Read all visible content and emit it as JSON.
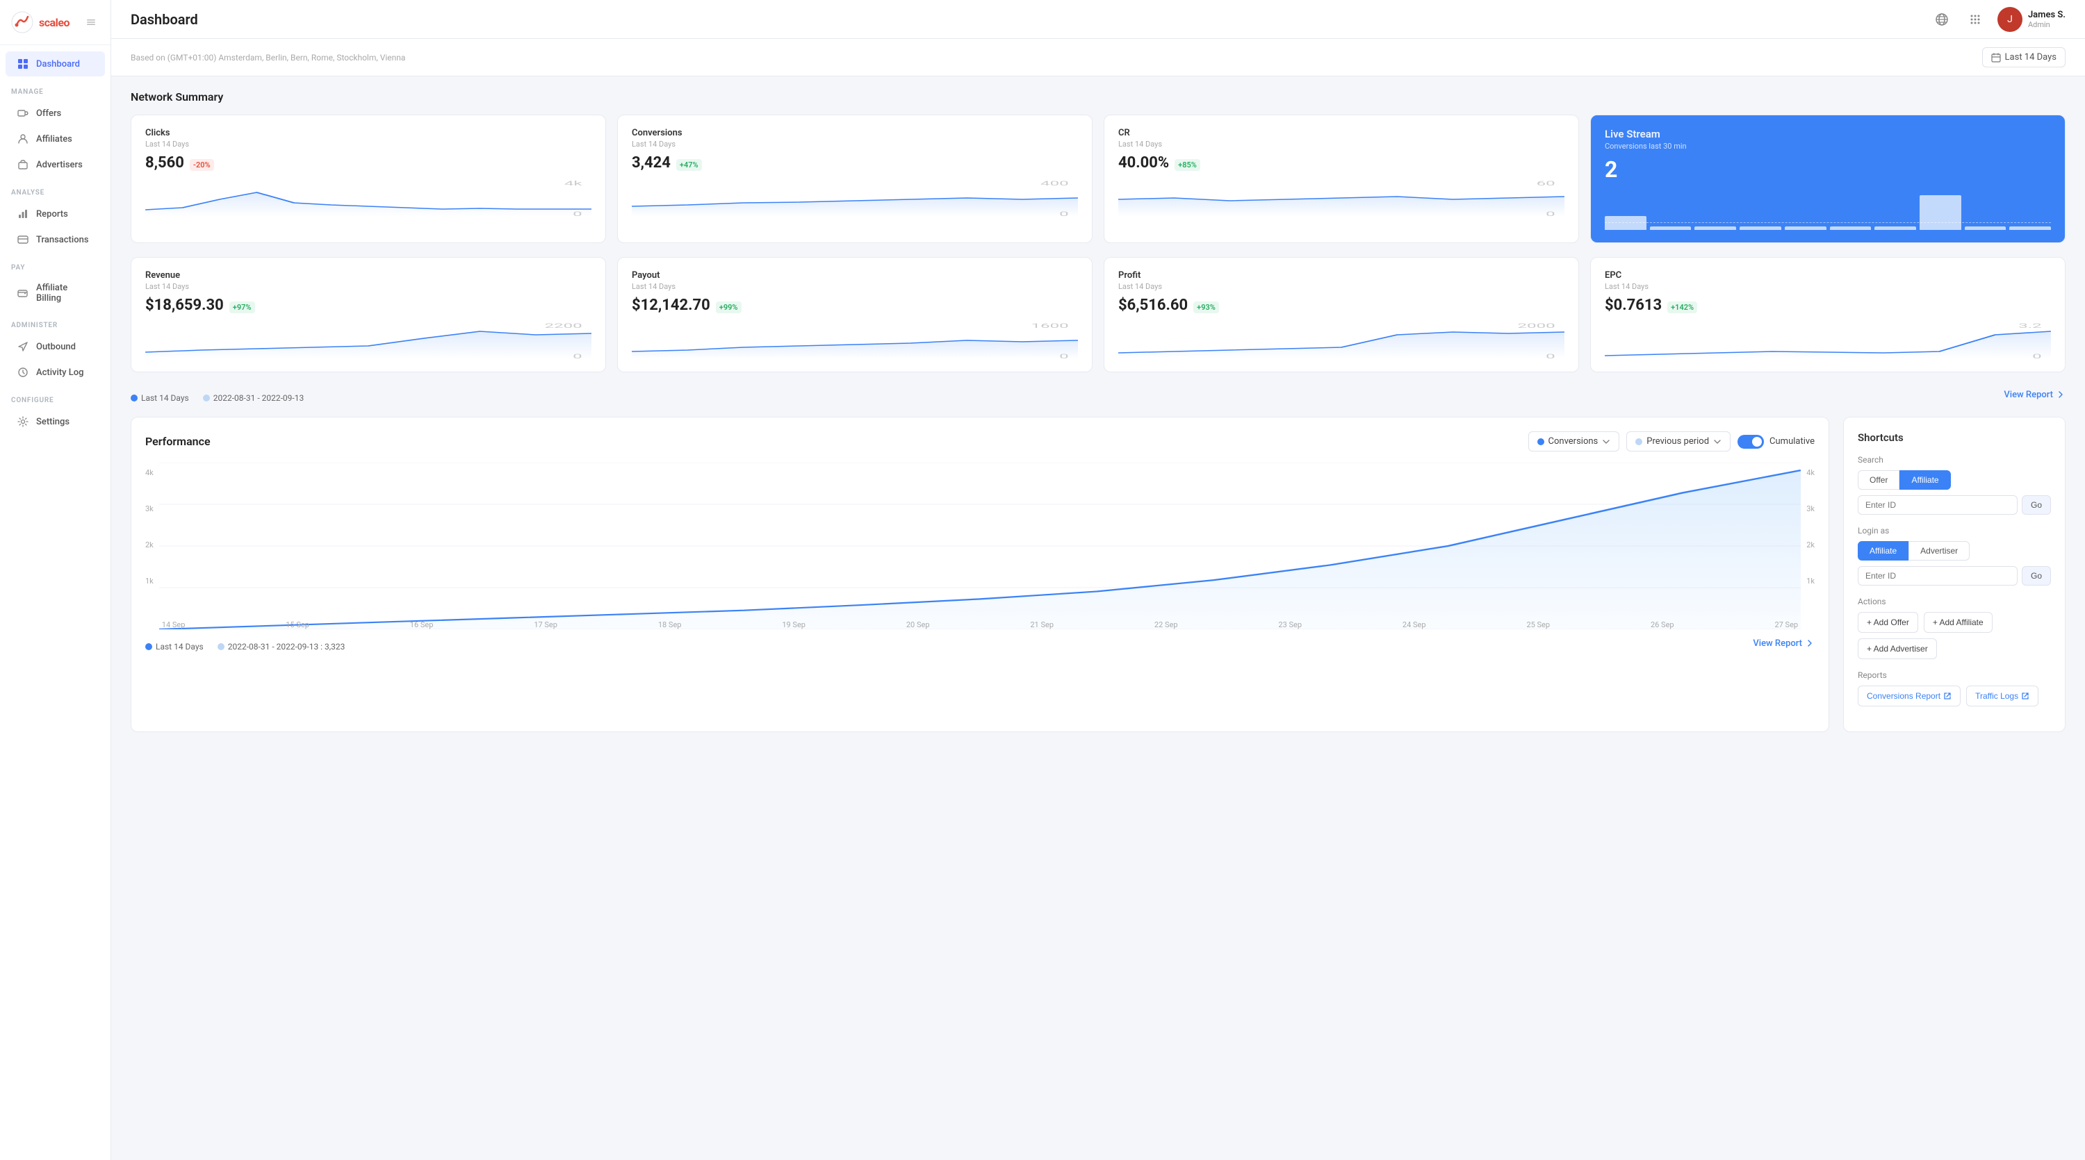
{
  "app": {
    "name": "scaleo",
    "logo_text": "scaleo"
  },
  "topbar": {
    "title": "Dashboard",
    "user_name": "James S.",
    "user_role": "Admin"
  },
  "sub_header": {
    "timezone": "Based on (GMT+01:00) Amsterdam, Berlin, Bern, Rome, Stockholm, Vienna",
    "date_range": "Last 14 Days"
  },
  "sidebar": {
    "manage_label": "MANAGE",
    "analyse_label": "ANALYSE",
    "pay_label": "PAY",
    "administer_label": "ADMINISTER",
    "configure_label": "CONFIGURE",
    "items": [
      {
        "id": "dashboard",
        "label": "Dashboard",
        "icon": "grid"
      },
      {
        "id": "offers",
        "label": "Offers",
        "icon": "tag"
      },
      {
        "id": "affiliates",
        "label": "Affiliates",
        "icon": "user"
      },
      {
        "id": "advertisers",
        "label": "Advertisers",
        "icon": "briefcase"
      },
      {
        "id": "reports",
        "label": "Reports",
        "icon": "bar-chart"
      },
      {
        "id": "transactions",
        "label": "Transactions",
        "icon": "credit-card"
      },
      {
        "id": "affiliate-billing",
        "label": "Affiliate Billing",
        "icon": "wallet"
      },
      {
        "id": "outbound",
        "label": "Outbound",
        "icon": "send"
      },
      {
        "id": "activity-log",
        "label": "Activity Log",
        "icon": "clock"
      },
      {
        "id": "settings",
        "label": "Settings",
        "icon": "gear"
      }
    ]
  },
  "network_summary": {
    "title": "Network Summary",
    "stats": [
      {
        "id": "clicks",
        "label": "Clicks",
        "period": "Last 14 Days",
        "value": "8,560",
        "badge": "-20%",
        "badge_type": "red"
      },
      {
        "id": "conversions",
        "label": "Conversions",
        "period": "Last 14 Days",
        "value": "3,424",
        "badge": "+47%",
        "badge_type": "green"
      },
      {
        "id": "cr",
        "label": "CR",
        "period": "Last 14 Days",
        "value": "40.00%",
        "badge": "+85%",
        "badge_type": "green"
      },
      {
        "id": "live",
        "label": "Live Stream",
        "period": "Conversions last 30 min",
        "value": "2",
        "type": "live"
      }
    ],
    "stats2": [
      {
        "id": "revenue",
        "label": "Revenue",
        "period": "Last 14 Days",
        "value": "$18,659.30",
        "badge": "+97%",
        "badge_type": "green"
      },
      {
        "id": "payout",
        "label": "Payout",
        "period": "Last 14 Days",
        "value": "$12,142.70",
        "badge": "+99%",
        "badge_type": "green"
      },
      {
        "id": "profit",
        "label": "Profit",
        "period": "Last 14 Days",
        "value": "$6,516.60",
        "badge": "+93%",
        "badge_type": "green"
      },
      {
        "id": "epc",
        "label": "EPC",
        "period": "Last 14 Days",
        "value": "$0.7613",
        "badge": "+142%",
        "badge_type": "green"
      }
    ],
    "legend": {
      "item1": "Last 14 Days",
      "item2": "2022-08-31 - 2022-09-13"
    },
    "view_report": "View Report"
  },
  "performance": {
    "title": "Performance",
    "dropdown1": "Conversions",
    "dropdown2": "Previous period",
    "toggle_label": "Cumulative",
    "x_axis": [
      "14 Sep",
      "15 Sep",
      "16 Sep",
      "17 Sep",
      "18 Sep",
      "19 Sep",
      "20 Sep",
      "21 Sep",
      "22 Sep",
      "23 Sep",
      "24 Sep",
      "25 Sep",
      "26 Sep",
      "27 Sep"
    ],
    "y_left": [
      "4k",
      "3k",
      "2k",
      "1k"
    ],
    "y_right": [
      "4k",
      "3k",
      "2k",
      "1k"
    ],
    "legend_item1": "Last 14 Days",
    "legend_item2": "2022-08-31 - 2022-09-13 : 3,323",
    "view_report": "View Report"
  },
  "shortcuts": {
    "title": "Shortcuts",
    "search_label": "Search",
    "search_tab1": "Offer",
    "search_tab2": "Affiliate",
    "search_placeholder": "Enter ID",
    "go_label": "Go",
    "login_label": "Login as",
    "login_tab1": "Affiliate",
    "login_tab2": "Advertiser",
    "login_placeholder": "Enter ID",
    "login_go_label": "Go",
    "actions_label": "Actions",
    "add_offer": "+ Add Offer",
    "add_affiliate": "+ Add Affiliate",
    "add_advertiser": "+ Add Advertiser",
    "reports_label": "Reports",
    "conversions_report": "Conversions Report",
    "traffic_logs": "Traffic Logs"
  }
}
